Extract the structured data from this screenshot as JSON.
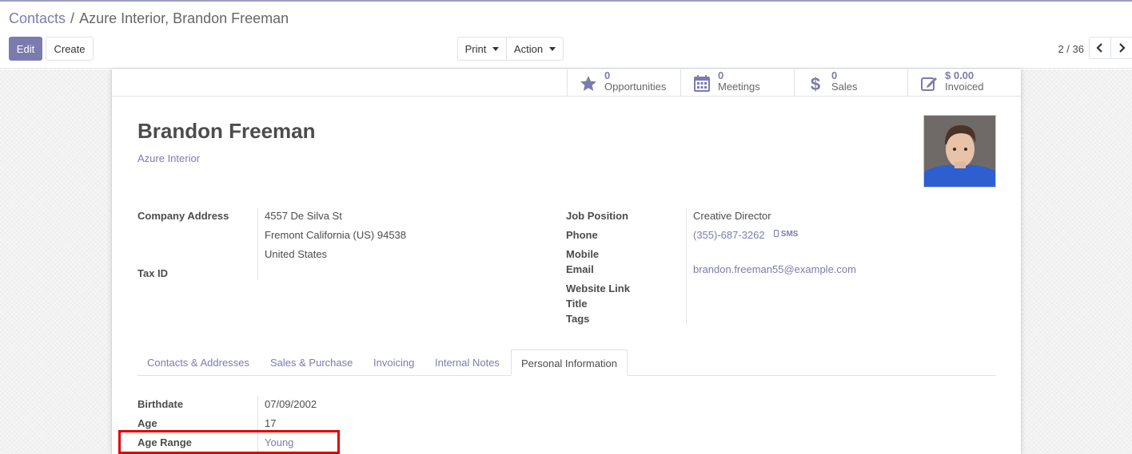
{
  "breadcrumb": {
    "parent": "Contacts",
    "separator": "/",
    "current": "Azure Interior, Brandon Freeman"
  },
  "toolbar": {
    "edit_label": "Edit",
    "create_label": "Create",
    "print_label": "Print",
    "action_label": "Action"
  },
  "pager": {
    "value": "2 / 36"
  },
  "stats": [
    {
      "value": "0",
      "label": "Opportunities",
      "icon": "star-icon"
    },
    {
      "value": "0",
      "label": "Meetings",
      "icon": "calendar-icon"
    },
    {
      "value": "0",
      "label": "Sales",
      "icon": "dollar-icon"
    },
    {
      "value": "$ 0.00",
      "label": "Invoiced",
      "icon": "edit-icon"
    }
  ],
  "contact": {
    "name": "Brandon Freeman",
    "company": "Azure Interior"
  },
  "left_fields": {
    "company_address_label": "Company Address",
    "address_line1": "4557 De Silva St",
    "address_line2": "Fremont  California (US)  94538",
    "address_line3": "United States",
    "tax_id_label": "Tax ID"
  },
  "right_fields": {
    "job_position_label": "Job Position",
    "job_position_value": "Creative Director",
    "phone_label": "Phone",
    "phone_value": "(355)-687-3262",
    "sms_label": "SMS",
    "mobile_label": "Mobile",
    "email_label": "Email",
    "email_value": "brandon.freeman55@example.com",
    "website_label": "Website Link",
    "title_label": "Title",
    "tags_label": "Tags"
  },
  "tabs": [
    "Contacts & Addresses",
    "Sales & Purchase",
    "Invoicing",
    "Internal Notes",
    "Personal Information"
  ],
  "active_tab": "Personal Information",
  "personal": {
    "birthdate_label": "Birthdate",
    "birthdate_value": "07/09/2002",
    "age_label": "Age",
    "age_value": "17",
    "age_range_label": "Age Range",
    "age_range_value": "Young"
  },
  "colors": {
    "accent": "#7c7bad",
    "highlight": "#e00000"
  }
}
